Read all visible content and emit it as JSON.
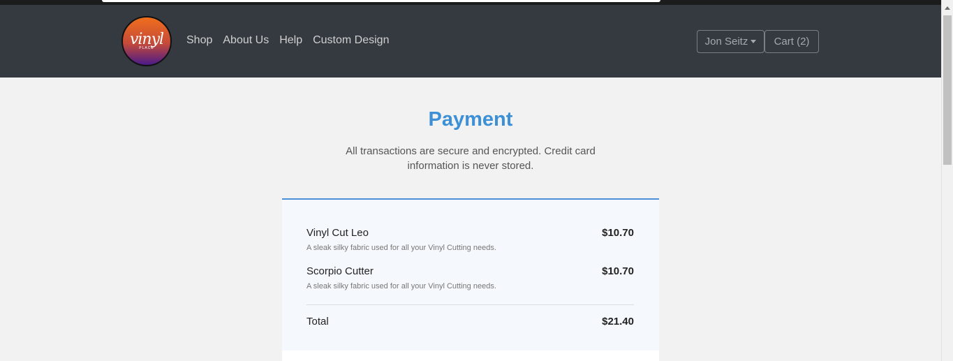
{
  "brand": {
    "logo_text": "vinyl",
    "logo_sub": "PLACE"
  },
  "nav": {
    "links": [
      "Shop",
      "About Us",
      "Help",
      "Custom Design"
    ]
  },
  "user_menu": {
    "label": "Jon Seitz"
  },
  "cart": {
    "label": "Cart (2)"
  },
  "page": {
    "title": "Payment",
    "subtitle": "All transactions are secure and encrypted. Credit card information is never stored."
  },
  "order": {
    "items": [
      {
        "name": "Vinyl Cut Leo",
        "price": "$10.70",
        "description": "A sleak silky fabric used for all your Vinyl Cutting needs."
      },
      {
        "name": "Scorpio Cutter",
        "price": "$10.70",
        "description": "A sleak silky fabric used for all your Vinyl Cutting needs."
      }
    ],
    "total_label": "Total",
    "total_value": "$21.40"
  },
  "colors": {
    "navbar": "#343a40",
    "accent": "#3d8fd6",
    "background": "#f2f2f2"
  }
}
